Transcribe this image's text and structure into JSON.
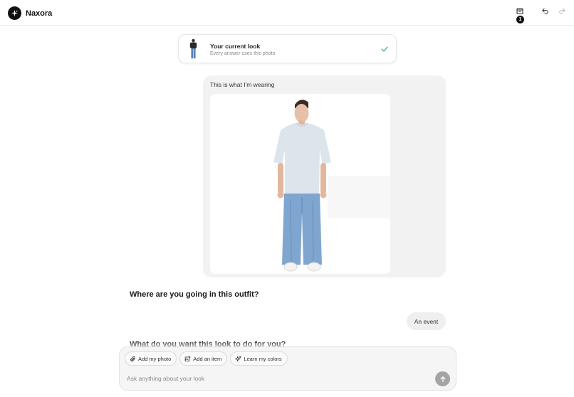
{
  "app": {
    "name": "Naxora"
  },
  "header": {
    "cart_count": "1"
  },
  "current_look": {
    "title": "Your current look",
    "subtitle": "Every answer uses this photo"
  },
  "messages": {
    "user_photo_caption": "This is what I'm wearing",
    "assistant_question_1": "Where are you going in this outfit?",
    "user_reply_1": "An event",
    "assistant_question_2": "What do you want this look to do for you?"
  },
  "composer": {
    "chips": [
      {
        "label": "Add my photo",
        "icon": "paperclip-icon"
      },
      {
        "label": "Add an item",
        "icon": "image-add-icon"
      },
      {
        "label": "Learn my colors",
        "icon": "sparkle-icon"
      }
    ],
    "placeholder": "Ask anything about your look"
  },
  "colors": {
    "accent": "#111111",
    "check": "#3aa17e",
    "bubble": "#f2f2f3",
    "send_disabled": "#a4a4a4"
  }
}
